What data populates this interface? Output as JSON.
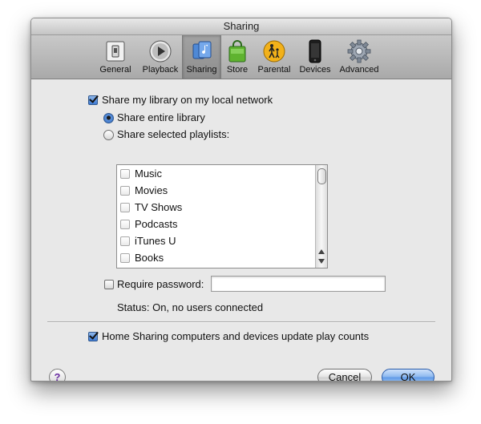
{
  "window": {
    "title": "Sharing"
  },
  "toolbar": {
    "items": [
      {
        "label": "General",
        "icon": "switch-icon"
      },
      {
        "label": "Playback",
        "icon": "play-icon"
      },
      {
        "label": "Sharing",
        "icon": "sharing-icon",
        "selected": true
      },
      {
        "label": "Store",
        "icon": "shopping-bag-icon"
      },
      {
        "label": "Parental",
        "icon": "parental-icon"
      },
      {
        "label": "Devices",
        "icon": "iphone-icon"
      },
      {
        "label": "Advanced",
        "icon": "gear-icon"
      }
    ]
  },
  "sharing": {
    "share_library": {
      "label": "Share my library on my local network",
      "checked": true
    },
    "share_entire": {
      "label": "Share entire library",
      "selected": true
    },
    "share_selected": {
      "label": "Share selected playlists:",
      "selected": false
    },
    "playlists": [
      {
        "label": "Music",
        "checked": false
      },
      {
        "label": "Movies",
        "checked": false
      },
      {
        "label": "TV Shows",
        "checked": false
      },
      {
        "label": "Podcasts",
        "checked": false
      },
      {
        "label": "iTunes U",
        "checked": false
      },
      {
        "label": "Books",
        "checked": false
      }
    ],
    "require_password": {
      "label": "Require password:",
      "checked": false,
      "value": ""
    },
    "status": "Status: On, no users connected",
    "home_sharing": {
      "label": "Home Sharing computers and devices update play counts",
      "checked": true
    }
  },
  "footer": {
    "help_label": "?",
    "cancel_label": "Cancel",
    "ok_label": "OK"
  },
  "colors": {
    "accent": "#3d7ad3",
    "window_background": "#e8e8e8",
    "help_glyph": "#6b2fa3"
  }
}
